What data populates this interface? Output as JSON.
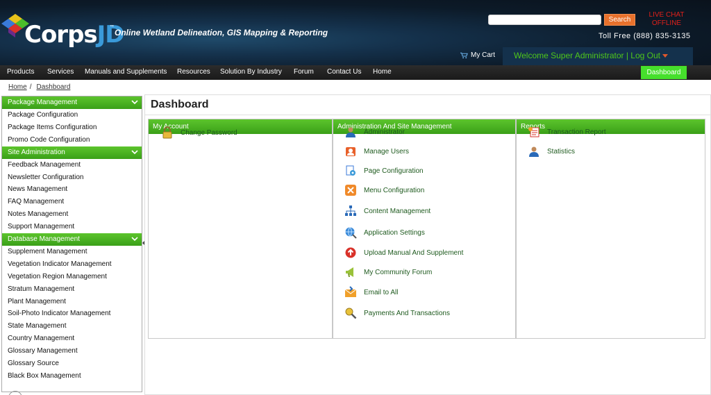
{
  "header": {
    "logo_text_a": "Corps",
    "logo_text_b": "JD",
    "trademark": "™",
    "tagline": "Online Wetland Delineation, GIS Mapping & Reporting",
    "search_placeholder": "",
    "search_button": "Search",
    "live_chat_line1": "LIVE CHAT",
    "live_chat_line2": "OFFLINE",
    "toll_free": "Toll Free (888) 835-3135",
    "cart_label": "My Cart",
    "welcome_text": "Welcome  Super Administrator | Log Out"
  },
  "nav": {
    "items": [
      "Products",
      "Services",
      "Manuals and Supplements",
      "Resources",
      "Solution By Industry",
      "Forum",
      "Contact Us",
      "Home"
    ],
    "dashboard_button": "Dashboard"
  },
  "breadcrumb": {
    "home": "Home",
    "separator": "/",
    "current": "Dashboard"
  },
  "sidebar": {
    "sections": [
      {
        "title": "Package Management",
        "items": [
          "Package Configuration",
          "Package Items Configuration",
          "Promo Code Configuration"
        ]
      },
      {
        "title": "Site Administration",
        "items": [
          "Feedback Management",
          "Newsletter Configuration",
          "News Management",
          "FAQ Management",
          "Notes Management",
          "Support Management"
        ]
      },
      {
        "title": "Database Management",
        "items": [
          "Supplement Management",
          "Vegetation Indicator Management",
          "Vegetation Region Management",
          "Stratum Management",
          "Plant Management",
          "Soil-Photo Indicator Management",
          "State Management",
          "Country Management",
          "Glossary Management",
          "Glossary Source",
          "Black Box Management"
        ]
      }
    ]
  },
  "main": {
    "title": "Dashboard",
    "panels": [
      {
        "title": "My Account",
        "items": [
          {
            "label": "Change Password",
            "icon": "lock-icon"
          }
        ]
      },
      {
        "title": "Administration And Site Management",
        "items": [
          {
            "label": "Administrator",
            "icon": "admin-user-icon"
          },
          {
            "label": "Manage Users",
            "icon": "users-icon"
          },
          {
            "label": "Page Configuration",
            "icon": "page-config-icon"
          },
          {
            "label": "Menu Configuration",
            "icon": "menu-config-icon"
          },
          {
            "label": "Content Management",
            "icon": "sitemap-icon"
          },
          {
            "label": "Application Settings",
            "icon": "settings-globe-icon"
          },
          {
            "label": "Upload Manual And Supplement",
            "icon": "upload-icon"
          },
          {
            "label": "My Community Forum",
            "icon": "megaphone-icon"
          },
          {
            "label": "Email to All",
            "icon": "email-icon"
          },
          {
            "label": "Payments And Transactions",
            "icon": "payments-icon"
          }
        ]
      },
      {
        "title": "Reports",
        "items": [
          {
            "label": "Transaction Report",
            "icon": "report-icon"
          },
          {
            "label": "Statistics",
            "icon": "statistics-icon"
          }
        ]
      }
    ]
  },
  "colors": {
    "accent_green": "#3aa018",
    "dashboard_green": "#46e02c",
    "search_orange": "#e8712c",
    "live_chat_red": "#e0201a",
    "welcome_green": "#4fc71a"
  }
}
